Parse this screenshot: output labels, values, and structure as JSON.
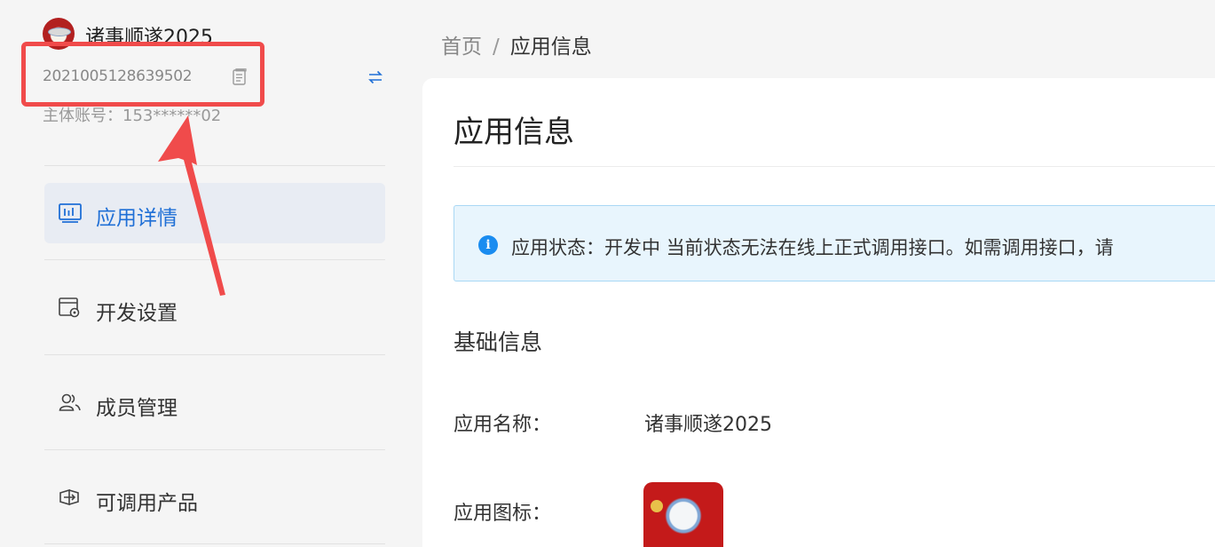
{
  "sidebar": {
    "app_name": "诸事顺遂2025",
    "app_id": "2021005128639502",
    "main_account_label": "主体账号：153******02",
    "items": [
      {
        "label": "应用详情",
        "icon": "chart-icon",
        "active": true
      },
      {
        "label": "开发设置",
        "icon": "settings-window-icon",
        "active": false
      },
      {
        "label": "成员管理",
        "icon": "members-icon",
        "active": false
      },
      {
        "label": "可调用产品",
        "icon": "products-icon",
        "active": false
      }
    ]
  },
  "breadcrumb": {
    "home": "首页",
    "separator": "/",
    "current": "应用信息"
  },
  "main": {
    "title": "应用信息",
    "alert": {
      "text": "应用状态：开发中 当前状态无法在线上正式调用接口。如需调用接口，请"
    },
    "section_title": "基础信息",
    "fields": [
      {
        "label": "应用名称：",
        "value": "诸事顺遂2025"
      },
      {
        "label": "应用图标：",
        "value": ""
      }
    ]
  },
  "colors": {
    "accent": "#1f6fd6",
    "annotation": "#f04b4b",
    "alert_bg": "#e8f5fd",
    "info": "#1a8cf0"
  }
}
